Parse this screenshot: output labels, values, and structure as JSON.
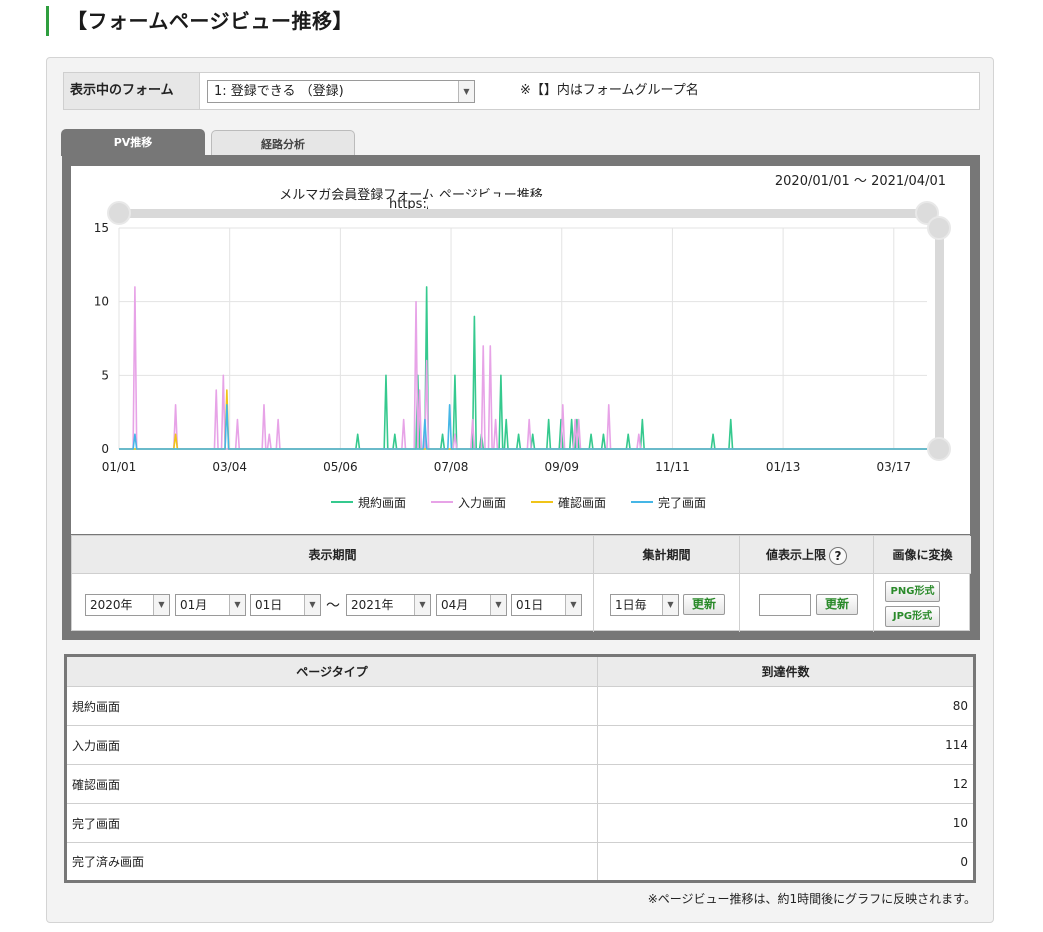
{
  "page_title": "【フォームページビュー推移】",
  "form_selector": {
    "label": "表示中のフォーム",
    "selected": "1: 登録できる （登録)",
    "note": "※【】内はフォームグループ名"
  },
  "tabs": [
    {
      "label": "PV推移",
      "active": true
    },
    {
      "label": "経路分析",
      "active": false
    }
  ],
  "chart_header": {
    "date_range": "2020/01/01 ～ 2021/04/01",
    "url_label": "https:/"
  },
  "chart_data": {
    "type": "line",
    "title": "メルマガ会員登録フォーム ページビュー推移",
    "x_tick_labels": [
      "01/01",
      "03/04",
      "05/06",
      "07/08",
      "09/09",
      "11/11",
      "01/13",
      "03/17"
    ],
    "y_tick_labels": [
      "15",
      "10",
      "5",
      "0"
    ],
    "ylim": [
      0,
      15
    ],
    "x_days": 457,
    "legend_position": "bottom",
    "series": [
      {
        "name": "規約画面",
        "color": "#35c98e",
        "points": [
          [
            135,
            1
          ],
          [
            151,
            5
          ],
          [
            156,
            1
          ],
          [
            169,
            5
          ],
          [
            174,
            11
          ],
          [
            183,
            1
          ],
          [
            190,
            5
          ],
          [
            201,
            9
          ],
          [
            205,
            1
          ],
          [
            216,
            5
          ],
          [
            219,
            2
          ],
          [
            226,
            1
          ],
          [
            234,
            1
          ],
          [
            243,
            2
          ],
          [
            250,
            2
          ],
          [
            256,
            2
          ],
          [
            259,
            2
          ],
          [
            267,
            1
          ],
          [
            274,
            1
          ],
          [
            288,
            1
          ],
          [
            296,
            2
          ],
          [
            336,
            1
          ],
          [
            346,
            2
          ]
        ]
      },
      {
        "name": "入力画面",
        "color": "#e7a3e7",
        "points": [
          [
            9,
            11
          ],
          [
            32,
            3
          ],
          [
            55,
            4
          ],
          [
            59,
            5
          ],
          [
            67,
            2
          ],
          [
            82,
            3
          ],
          [
            85,
            1
          ],
          [
            90,
            2
          ],
          [
            161,
            2
          ],
          [
            168,
            10
          ],
          [
            170,
            4
          ],
          [
            174,
            6
          ],
          [
            190,
            1
          ],
          [
            200,
            2
          ],
          [
            206,
            7
          ],
          [
            210,
            7
          ],
          [
            213,
            2
          ],
          [
            232,
            2
          ],
          [
            251,
            3
          ],
          [
            258,
            2
          ],
          [
            260,
            2
          ],
          [
            277,
            3
          ],
          [
            294,
            1
          ]
        ]
      },
      {
        "name": "確認画面",
        "color": "#f0c419",
        "points": [
          [
            32,
            1
          ],
          [
            61,
            4
          ]
        ]
      },
      {
        "name": "完了画面",
        "color": "#45b6e6",
        "points": [
          [
            9,
            1
          ],
          [
            61,
            3
          ],
          [
            173,
            2
          ],
          [
            187,
            3
          ]
        ]
      }
    ]
  },
  "period_controls": {
    "display_period_label": "表示期間",
    "aggregate_label": "集計期間",
    "value_limit_label": "値表示上限",
    "value_limit_value": "",
    "export_label": "画像に変換",
    "from_year": "2020年",
    "from_month": "01月",
    "from_day": "01日",
    "tilde": "～",
    "to_year": "2021年",
    "to_month": "04月",
    "to_day": "01日",
    "interval": "1日毎",
    "update_label": "更新",
    "png_label": "PNG形式",
    "jpg_label": "JPG形式"
  },
  "count_table": {
    "headers": [
      "ページタイプ",
      "到達件数"
    ],
    "rows": [
      {
        "type": "規約画面",
        "count": "80"
      },
      {
        "type": "入力画面",
        "count": "114"
      },
      {
        "type": "確認画面",
        "count": "12"
      },
      {
        "type": "完了画面",
        "count": "10"
      },
      {
        "type": "完了済み画面",
        "count": "0"
      }
    ]
  },
  "footnote": "※ページビュー推移は、約1時間後にグラフに反映されます。"
}
